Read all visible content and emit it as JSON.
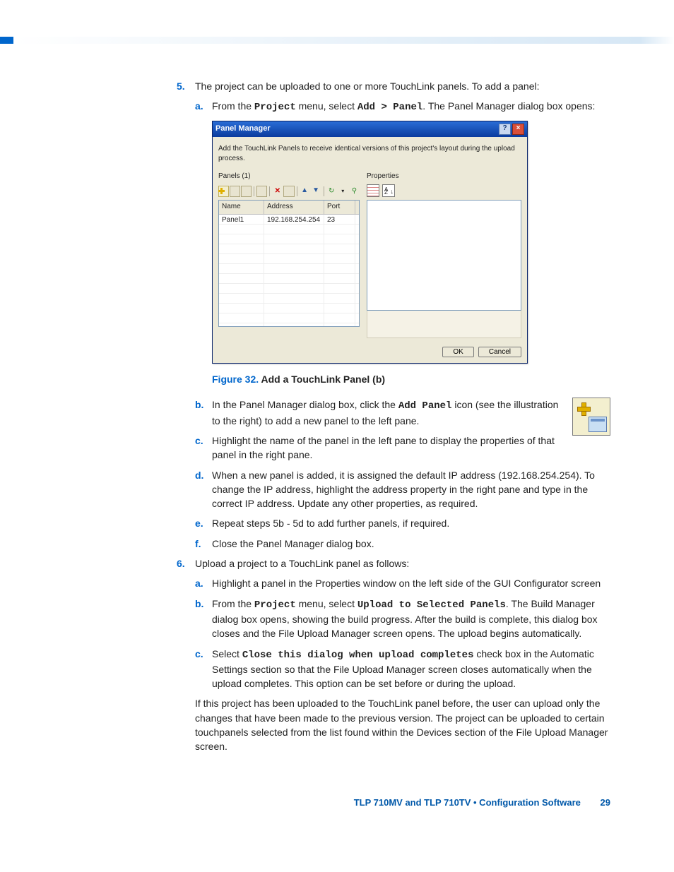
{
  "steps": {
    "s5": {
      "num": "5.",
      "text": "The project can be uploaded to one or more TouchLink panels. To add a panel:",
      "a": {
        "label": "a.",
        "pre": "From the ",
        "m1": "Project",
        "mid1": " menu, select ",
        "m2": "Add > Panel",
        "post": ". The Panel Manager dialog box opens:"
      },
      "b": {
        "label": "b.",
        "pre": "In the Panel Manager dialog box, click the ",
        "m1": "Add Panel",
        "post": " icon (see the illustration to the right) to add a new panel to the left pane."
      },
      "c": {
        "label": "c.",
        "text": "Highlight the name of the panel in the left pane to display the properties of that panel in the right pane."
      },
      "d": {
        "label": "d.",
        "text": "When a new panel is added, it is assigned the default IP address (192.168.254.254). To change the IP address, highlight the address property in the right pane and type in the correct IP address. Update any other properties, as required."
      },
      "e": {
        "label": "e.",
        "text": "Repeat steps 5b - 5d to add further panels, if required."
      },
      "f": {
        "label": "f.",
        "text": "Close the Panel Manager dialog box."
      }
    },
    "s6": {
      "num": "6.",
      "text": "Upload a project to a TouchLink panel as follows:",
      "a": {
        "label": "a.",
        "text": "Highlight a panel in the Properties window on the left side of the GUI Configurator screen"
      },
      "b": {
        "label": "b.",
        "pre": "From the ",
        "m1": "Project",
        "mid1": " menu, select ",
        "m2": "Upload to Selected Panels",
        "post": ". The Build Manager dialog box opens, showing the build progress. After the build is complete, this dialog box closes and the File Upload Manager screen opens. The upload begins automatically."
      },
      "c": {
        "label": "c.",
        "pre": "Select ",
        "m1": "Close this dialog when upload completes",
        "post": " check box in the Automatic Settings section so that the File Upload Manager screen closes automatically when the upload completes. This option can be set before or during the upload."
      }
    },
    "trail": "If this project has been uploaded to the TouchLink panel before, the user can upload only the changes that have been made to the previous version. The project can be uploaded to certain touchpanels selected from the list found within the Devices section of the File Upload Manager screen."
  },
  "figure": {
    "num": "Figure 32.",
    "title": " Add a TouchLink Panel (b)"
  },
  "dialog": {
    "title": "Panel Manager",
    "desc": "Add the TouchLink Panels to receive identical versions of this project's layout during the upload process.",
    "panels_label": "Panels (1)",
    "props_label": "Properties",
    "headers": {
      "name": "Name",
      "addr": "Address",
      "port": "Port"
    },
    "row": {
      "name": "Panel1",
      "addr": "192.168.254.254",
      "port": "23"
    },
    "ok": "OK",
    "cancel": "Cancel"
  },
  "footer": {
    "text": "TLP 710MV and TLP 710TV • Configuration Software",
    "page": "29"
  }
}
